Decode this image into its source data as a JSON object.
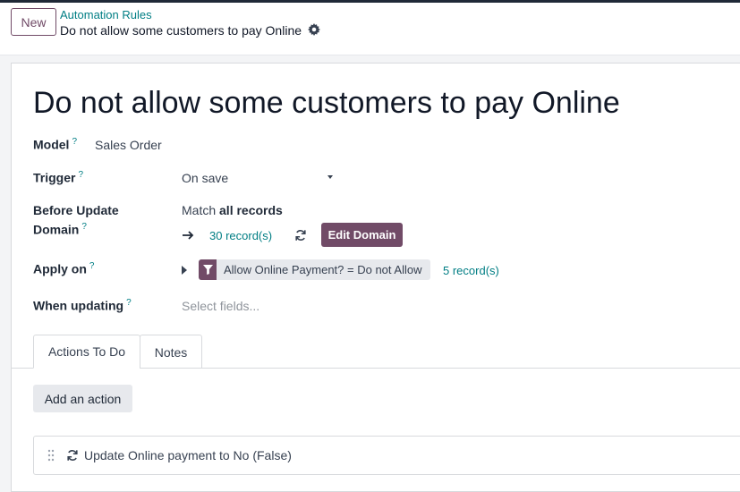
{
  "control_panel": {
    "new_button": "New",
    "breadcrumb_parent": "Automation Rules",
    "breadcrumb_current": "Do not allow some customers to pay Online",
    "gear_icon": "gear-icon"
  },
  "form": {
    "title": "Do not allow some customers to pay Online",
    "help_mark": "?",
    "model": {
      "label": "Model",
      "value": "Sales Order"
    },
    "trigger": {
      "label": "Trigger",
      "value": "On save"
    },
    "before_update": {
      "label_line1": "Before Update",
      "label_line2": "Domain",
      "match_prefix": "Match",
      "match_bold": "all records",
      "records_link": "30 record(s)",
      "edit_domain_button": "Edit Domain"
    },
    "apply_on": {
      "label": "Apply on",
      "filter_text": "Allow Online Payment? = Do not Allow",
      "records_link": "5 record(s)"
    },
    "when_updating": {
      "label": "When updating",
      "placeholder": "Select fields..."
    }
  },
  "tabs": [
    {
      "label": "Actions To Do",
      "active": true
    },
    {
      "label": "Notes",
      "active": false
    }
  ],
  "actions": {
    "add_button": "Add an action",
    "items": [
      {
        "label": "Update Online payment to No (False)"
      }
    ]
  },
  "colors": {
    "brand": "#714b67",
    "link": "#017e84"
  }
}
